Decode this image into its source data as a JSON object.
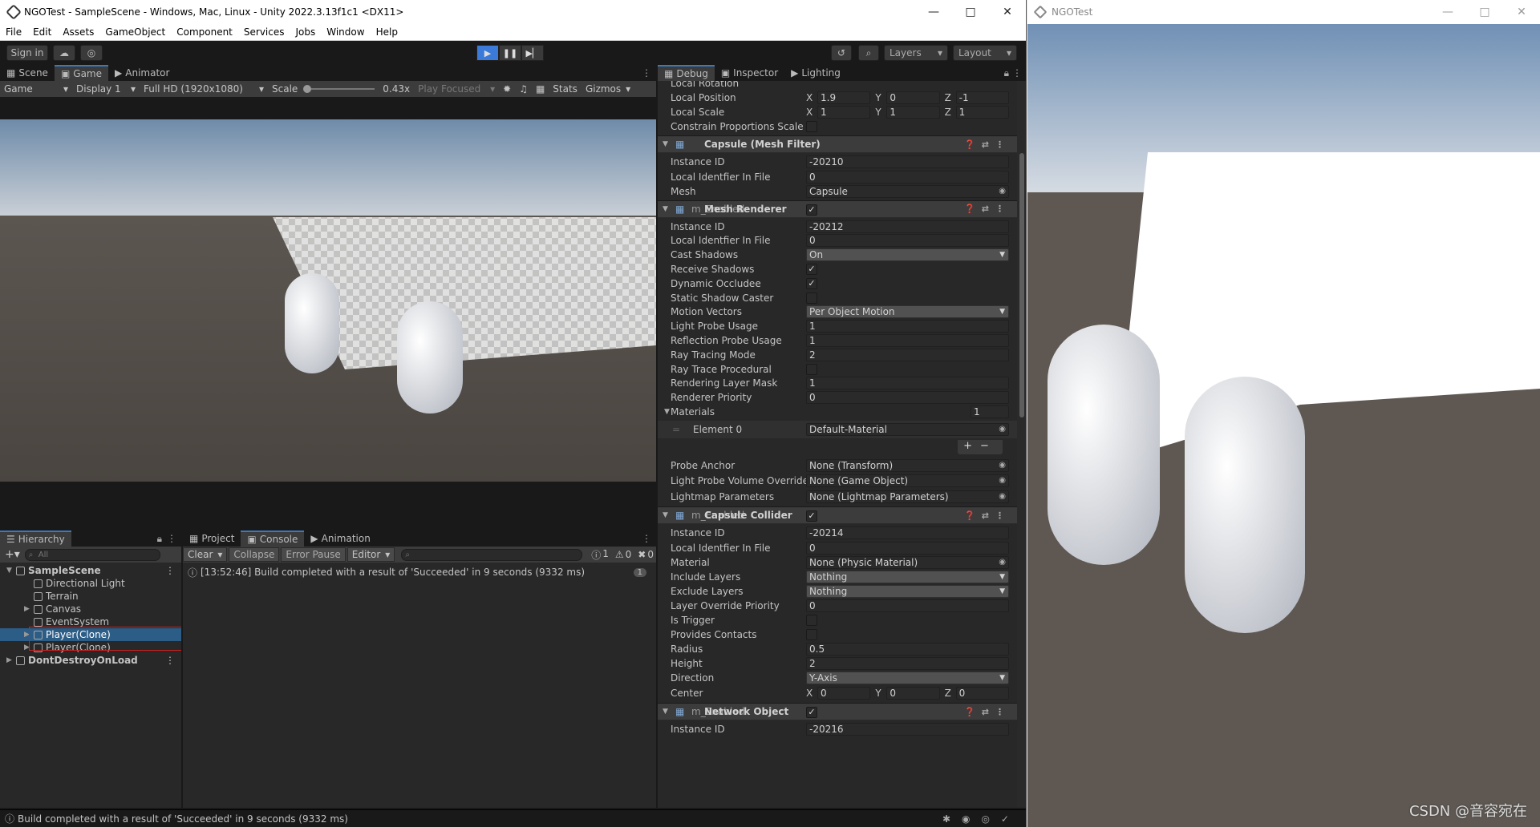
{
  "unity_window": {
    "title": "NGOTest - SampleScene - Windows, Mac, Linux - Unity 2022.3.13f1c1 <DX11>",
    "menu": [
      "File",
      "Edit",
      "Assets",
      "GameObject",
      "Component",
      "Services",
      "Jobs",
      "Window",
      "Help"
    ],
    "toolbar": {
      "sign_in": "Sign in",
      "layers": "Layers",
      "layout": "Layout"
    }
  },
  "game_panel": {
    "tabs": [
      "Scene",
      "Game",
      "Animator"
    ],
    "active_tab": "Game",
    "bar": {
      "mode": "Game",
      "display": "Display 1",
      "resolution": "Full HD (1920x1080)",
      "scale_label": "Scale",
      "scale_value": "0.43x",
      "play_focused": "Play Focused",
      "stats": "Stats",
      "gizmos": "Gizmos"
    }
  },
  "inspector_panel": {
    "tabs": [
      "Debug",
      "Inspector",
      "Lighting"
    ],
    "transform_rows": [
      {
        "label": "Local Rotation"
      },
      {
        "label": "Local Position",
        "x": "1.9",
        "y": "0",
        "z": "-1"
      },
      {
        "label": "Local Scale",
        "x": "1",
        "y": "1",
        "z": "1"
      },
      {
        "label": "Constrain Proportions Scale"
      }
    ],
    "mesh_filter": {
      "title": "Capsule (Mesh Filter)",
      "instance_id_label": "Instance ID",
      "instance_id": "-20210",
      "local_id_label": "Local Identfier In File",
      "local_id": "0",
      "mesh_label": "Mesh",
      "mesh": "Capsule"
    },
    "mesh_renderer": {
      "title": "Mesh Renderer",
      "prefix": "m_Enabled",
      "rows": [
        {
          "label": "Instance ID",
          "value": "-20212"
        },
        {
          "label": "Local Identfier In File",
          "value": "0"
        },
        {
          "label": "Cast Shadows",
          "value": "On",
          "type": "dropdown"
        },
        {
          "label": "Receive Shadows",
          "checked": true
        },
        {
          "label": "Dynamic Occludee",
          "checked": true
        },
        {
          "label": "Static Shadow Caster",
          "checked": false
        },
        {
          "label": "Motion Vectors",
          "value": "Per Object Motion",
          "type": "dropdown"
        },
        {
          "label": "Light Probe Usage",
          "value": "1"
        },
        {
          "label": "Reflection Probe Usage",
          "value": "1"
        },
        {
          "label": "Ray Tracing Mode",
          "value": "2"
        },
        {
          "label": "Ray Trace Procedural",
          "checked": false
        },
        {
          "label": "Rendering Layer Mask",
          "value": "1"
        },
        {
          "label": "Renderer Priority",
          "value": "0"
        }
      ],
      "materials_label": "Materials",
      "materials_count": "1",
      "element_label": "Element 0",
      "element_value": "Default-Material",
      "probe_anchor_label": "Probe Anchor",
      "probe_anchor": "None (Transform)",
      "lpvo_label": "Light Probe Volume Override",
      "lpvo": "None (Game Object)",
      "lightmap_label": "Lightmap Parameters",
      "lightmap": "None (Lightmap Parameters)"
    },
    "capsule_collider": {
      "title": "Capsule Collider",
      "prefix": "m_Enabled",
      "rows": [
        {
          "label": "Instance ID",
          "value": "-20214"
        },
        {
          "label": "Local Identfier In File",
          "value": "0"
        },
        {
          "label": "Material",
          "value": "None (Physic Material)",
          "type": "object"
        },
        {
          "label": "Include Layers",
          "value": "Nothing",
          "type": "dropdown"
        },
        {
          "label": "Exclude Layers",
          "value": "Nothing",
          "type": "dropdown"
        },
        {
          "label": "Layer Override Priority",
          "value": "0"
        },
        {
          "label": "Is Trigger",
          "checked": false
        },
        {
          "label": "Provides Contacts",
          "checked": false
        },
        {
          "label": "Radius",
          "value": "0.5"
        },
        {
          "label": "Height",
          "value": "2"
        },
        {
          "label": "Direction",
          "value": "Y-Axis",
          "type": "dropdown"
        }
      ],
      "center_label": "Center",
      "center": {
        "x": "0",
        "y": "0",
        "z": "0"
      }
    },
    "network_object": {
      "title": "Network Object",
      "prefix": "m_Enabled",
      "instance_id_label": "Instance ID",
      "instance_id": "-20216"
    }
  },
  "hierarchy_panel": {
    "tab": "Hierarchy",
    "search_placeholder": "All",
    "items": [
      {
        "label": "SampleScene",
        "depth": 0,
        "type": "scene"
      },
      {
        "label": "Directional Light",
        "depth": 1
      },
      {
        "label": "Terrain",
        "depth": 1
      },
      {
        "label": "Canvas",
        "depth": 1,
        "foldout": true
      },
      {
        "label": "EventSystem",
        "depth": 1
      },
      {
        "label": "Player(Clone)",
        "depth": 1,
        "foldout": true,
        "selected": true
      },
      {
        "label": "Player(Clone)",
        "depth": 1,
        "foldout": true
      },
      {
        "label": "DontDestroyOnLoad",
        "depth": 0,
        "type": "scene"
      }
    ]
  },
  "console_panel": {
    "tabs": [
      "Project",
      "Console",
      "Animation"
    ],
    "active_tab": "Console",
    "buttons": [
      "Clear",
      "Collapse",
      "Error Pause",
      "Editor"
    ],
    "counts": {
      "info": "1",
      "warn": "0",
      "error": "0"
    },
    "entries": [
      {
        "text": "[13:52:46] Build completed with a result of 'Succeeded' in 9 seconds (9332 ms)",
        "count": "1"
      }
    ]
  },
  "status_bar": {
    "text": "Build completed with a result of 'Succeeded' in 9 seconds (9332 ms)"
  },
  "ngo_window": {
    "title": "NGOTest"
  },
  "watermark": "CSDN @音容宛在",
  "colors": {
    "accent": "#3a79bb",
    "selection": "#2c5d87",
    "play_active": "#3b7ad9"
  }
}
